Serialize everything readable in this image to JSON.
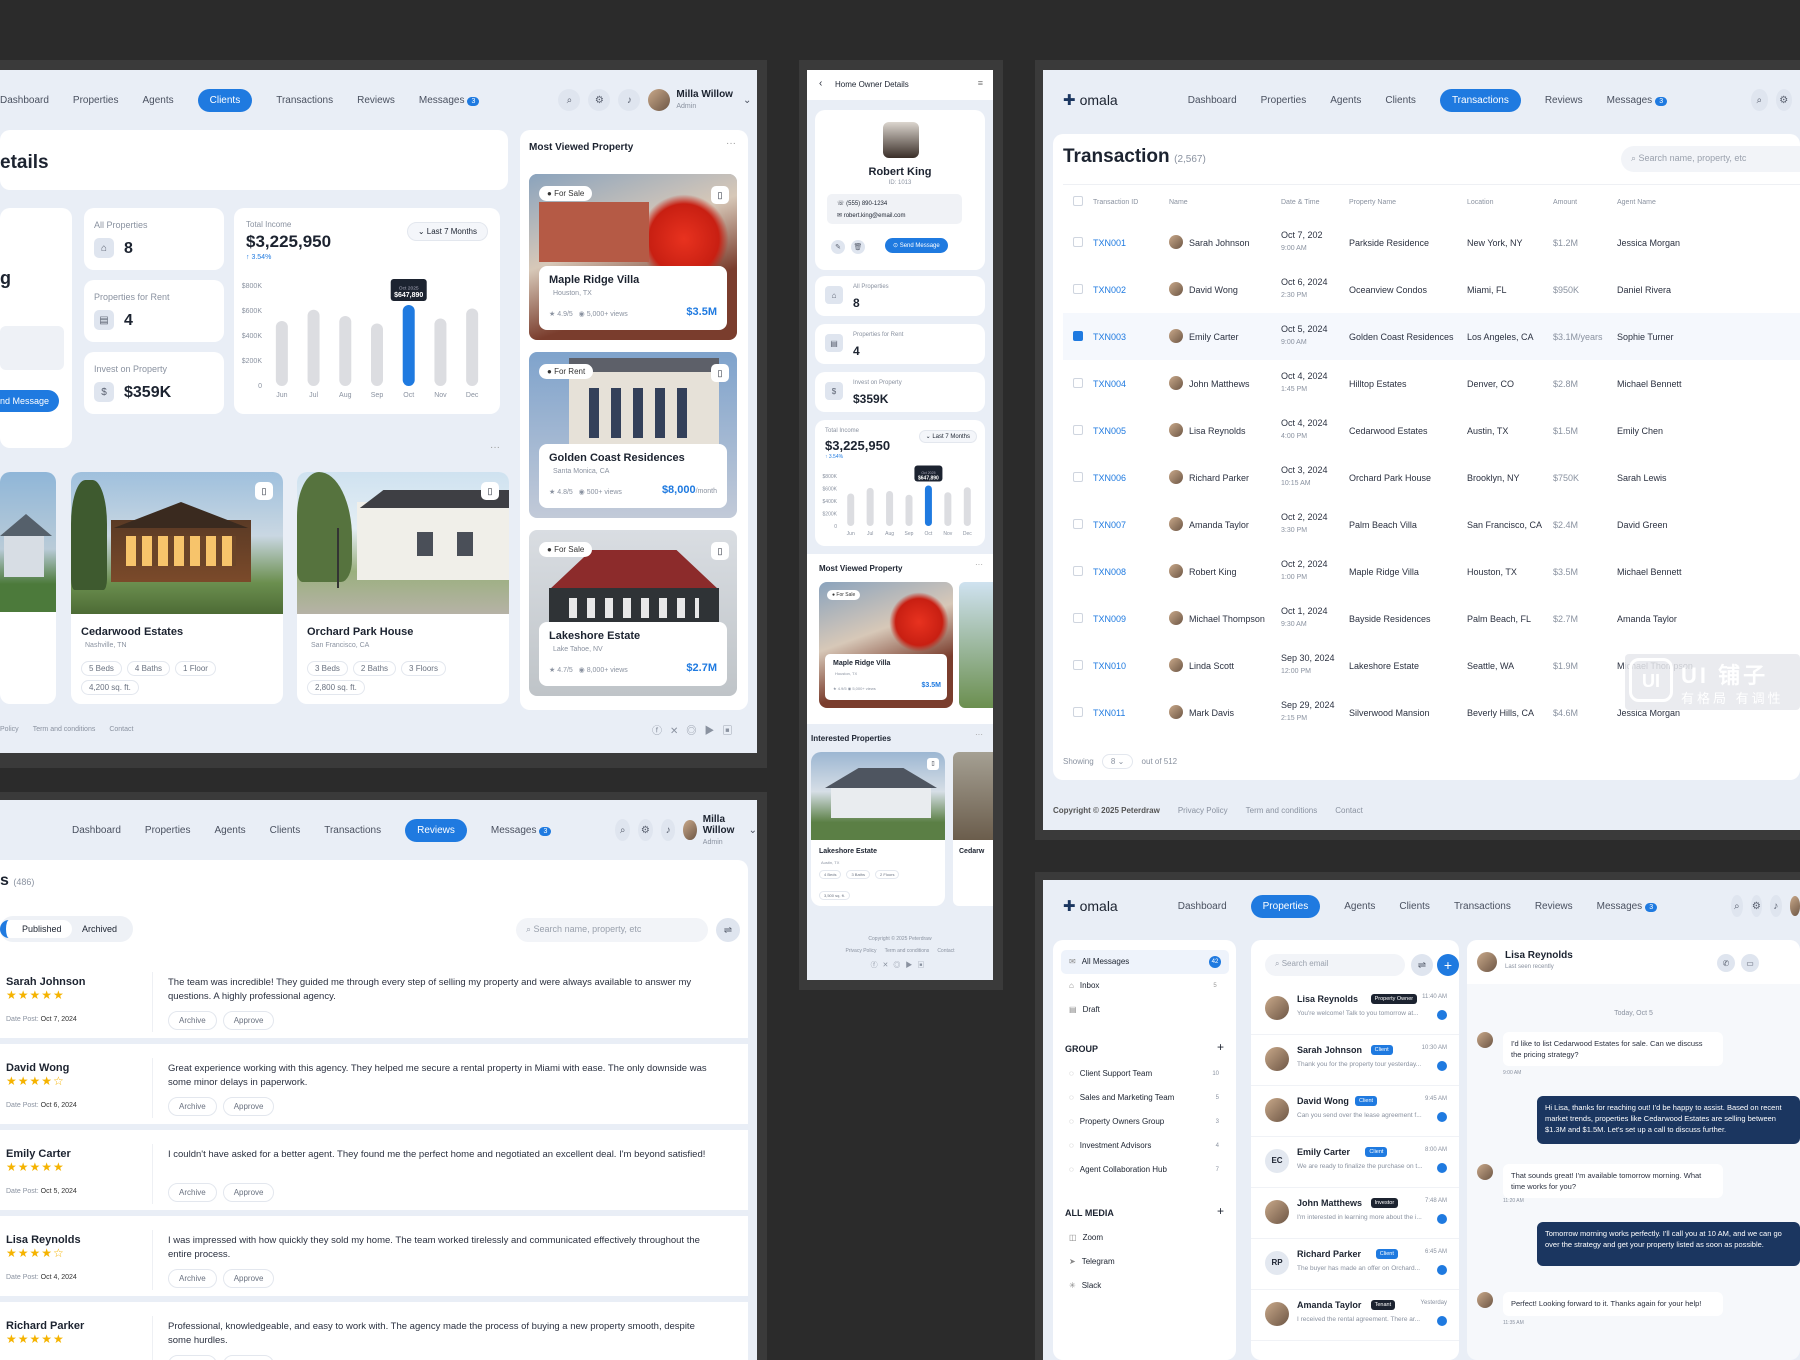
{
  "user": {
    "name": "Milla Willow",
    "role": "Admin"
  },
  "nav_a": [
    "Dashboard",
    "Properties",
    "Agents",
    "Clients",
    "Transactions",
    "Reviews",
    "Messages"
  ],
  "messages_badge": "3",
  "p1": {
    "active_tab": "Clients",
    "title": "etails",
    "stats": [
      {
        "label": "All Properties",
        "value": "8"
      },
      {
        "label": "Properties for Rent",
        "value": "4"
      },
      {
        "label": "Invest on Property",
        "value": "$359K"
      }
    ],
    "side_letter": "g",
    "send_btn": "nd Message",
    "income": {
      "label": "Total Income",
      "value": "$3,225,950",
      "delta": "↑ 3.54%",
      "range": "Last 7 Months",
      "tooltip_month": "Oct 2025",
      "tooltip_value": "$647,890"
    },
    "chart_data": {
      "type": "bar",
      "categories": [
        "Jun",
        "Jul",
        "Aug",
        "Sep",
        "Oct",
        "Nov",
        "Dec"
      ],
      "values": [
        520,
        610,
        560,
        500,
        647.89,
        540,
        620
      ],
      "highlight": "Oct",
      "ylabels": [
        "$800K",
        "$600K",
        "$400K",
        "$200K",
        "0"
      ],
      "ylim": [
        0,
        800
      ]
    },
    "bottom_props": [
      {
        "name": "Cedarwood Estates",
        "loc": "Nashville, TN",
        "beds": "5 Beds",
        "baths": "4 Baths",
        "floors": "1 Floor",
        "size": "4,200 sq. ft."
      },
      {
        "name": "Orchard Park House",
        "loc": "San Francisco, CA",
        "beds": "3 Beds",
        "baths": "2 Baths",
        "floors": "3 Floors",
        "size": "2,800 sq. ft."
      }
    ],
    "mv_title": "Most Viewed Property",
    "mv": [
      {
        "tag": "For Sale",
        "name": "Maple Ridge Villa",
        "loc": "Houston, TX",
        "rating": "4.9/5",
        "views": "5,000+ views",
        "price": "$3.5M",
        "per": ""
      },
      {
        "tag": "For Rent",
        "name": "Golden Coast Residences",
        "loc": "Santa Monica, CA",
        "rating": "4.8/5",
        "views": "500+ views",
        "price": "$8,000",
        "per": "/month"
      },
      {
        "tag": "For Sale",
        "name": "Lakeshore Estate",
        "loc": "Lake Tahoe, NV",
        "rating": "4.7/5",
        "views": "8,000+ views",
        "price": "$2.7M",
        "per": ""
      }
    ],
    "footer": [
      "Policy",
      "Term and conditions",
      "Contact"
    ]
  },
  "p2": {
    "header": "Home Owner Details",
    "name": "Robert King",
    "id": "ID: 1013",
    "phone": "(555) 890-1234",
    "email": "robert.king@email.com",
    "send": "Send Message",
    "stats": [
      {
        "label": "All Properties",
        "value": "8"
      },
      {
        "label": "Properties for Rent",
        "value": "4"
      },
      {
        "label": "Invest on Property",
        "value": "$359K"
      }
    ],
    "income_label": "Total Income",
    "income": "$3,225,950",
    "delta": "↑ 3.54%",
    "range": "Last 7 Months",
    "mv_title": "Most Viewed Property",
    "mv_card": {
      "tag": "For Sale",
      "name": "Maple Ridge Villa",
      "loc": "Houston, TX",
      "rating": "4.9/5",
      "views": "5,000+ views",
      "price": "$3.5M"
    },
    "int_title": "Interested Properties",
    "int_card": {
      "name": "Lakeshore Estate",
      "loc": "Austin, TX",
      "beds": "4 Beds",
      "baths": "3 Baths",
      "floors": "2 Floors",
      "size": "3,500 sq. ft."
    },
    "int_card2": "Cedarw",
    "copyright": "Copyright © 2025 Peterdraw",
    "links": [
      "Privacy Policy",
      "Term and conditions",
      "Contact"
    ]
  },
  "p3": {
    "brand": "omala",
    "active_tab": "Transactions",
    "title": "Transaction",
    "count": "(2,567)",
    "search": "Search name, property, etc",
    "headers": [
      "Transaction ID",
      "Name",
      "Date & Time",
      "Property Name",
      "Location",
      "Amount",
      "Agent Name"
    ],
    "rows": [
      {
        "id": "TXN001",
        "name": "Sarah Johnson",
        "date": "Oct 7, 202",
        "time": "9:00 AM",
        "prop": "Parkside Residence",
        "loc": "New York, NY",
        "amt": "$1.2M",
        "agent": "Jessica Morgan",
        "on": false
      },
      {
        "id": "TXN002",
        "name": "David Wong",
        "date": "Oct 6, 2024",
        "time": "2:30 PM",
        "prop": "Oceanview Condos",
        "loc": "Miami, FL",
        "amt": "$950K",
        "agent": "Daniel Rivera",
        "on": false
      },
      {
        "id": "TXN003",
        "name": "Emily Carter",
        "date": "Oct 5, 2024",
        "time": "9:00 AM",
        "prop": "Golden Coast Residences",
        "loc": "Los Angeles, CA",
        "amt": "$3.1M/years",
        "agent": "Sophie Turner",
        "on": true
      },
      {
        "id": "TXN004",
        "name": "John Matthews",
        "date": "Oct 4, 2024",
        "time": "1:45 PM",
        "prop": "Hilltop Estates",
        "loc": "Denver, CO",
        "amt": "$2.8M",
        "agent": "Michael Bennett",
        "on": false
      },
      {
        "id": "TXN005",
        "name": "Lisa Reynolds",
        "date": "Oct 4, 2024",
        "time": "4:00 PM",
        "prop": "Cedarwood Estates",
        "loc": "Austin, TX",
        "amt": "$1.5M",
        "agent": "Emily Chen",
        "on": false
      },
      {
        "id": "TXN006",
        "name": "Richard Parker",
        "date": "Oct 3, 2024",
        "time": "10:15 AM",
        "prop": "Orchard Park House",
        "loc": "Brooklyn, NY",
        "amt": "$750K",
        "agent": "Sarah Lewis",
        "on": false
      },
      {
        "id": "TXN007",
        "name": "Amanda Taylor",
        "date": "Oct 2, 2024",
        "time": "3:30 PM",
        "prop": "Palm Beach Villa",
        "loc": "San Francisco, CA",
        "amt": "$2.4M",
        "agent": "David Green",
        "on": false
      },
      {
        "id": "TXN008",
        "name": "Robert King",
        "date": "Oct 2, 2024",
        "time": "1:00 PM",
        "prop": "Maple Ridge Villa",
        "loc": "Houston, TX",
        "amt": "$3.5M",
        "agent": "Michael Bennett",
        "on": false
      },
      {
        "id": "TXN009",
        "name": "Michael Thompson",
        "date": "Oct 1, 2024",
        "time": "9:30 AM",
        "prop": "Bayside Residences",
        "loc": "Palm Beach, FL",
        "amt": "$2.7M",
        "agent": "Amanda Taylor",
        "on": false
      },
      {
        "id": "TXN010",
        "name": "Linda Scott",
        "date": "Sep 30, 2024",
        "time": "12:00 PM",
        "prop": "Lakeshore Estate",
        "loc": "Seattle, WA",
        "amt": "$1.9M",
        "agent": "Michael Thompson",
        "on": false
      },
      {
        "id": "TXN011",
        "name": "Mark Davis",
        "date": "Sep 29, 2024",
        "time": "2:15 PM",
        "prop": "Silverwood Mansion",
        "loc": "Beverly Hills, CA",
        "amt": "$4.6M",
        "agent": "Jessica Morgan",
        "on": false
      }
    ],
    "showing": "Showing",
    "per_page": "8",
    "of": "out of 512",
    "copyright": "Copyright © 2025 Peterdraw",
    "links": [
      "Privacy Policy",
      "Term and conditions",
      "Contact"
    ],
    "wm_big": "UI 铺子",
    "wm_small": "有格局 有调性"
  },
  "p4": {
    "active_tab": "Reviews",
    "title": "s",
    "count": "(486)",
    "tabs": [
      "Published",
      "Archived"
    ],
    "search": "Search name, property, etc",
    "date_label": "Date Post:",
    "archive": "Archive",
    "approve": "Approve",
    "reviews": [
      {
        "name": "Sarah Johnson",
        "stars": "★★★★★",
        "date": "Oct 7, 2024",
        "text": "The team was incredible! They guided me through every step of selling my property and were always available to answer my questions. A highly professional agency."
      },
      {
        "name": "David Wong",
        "stars": "★★★★☆",
        "date": "Oct 6, 2024",
        "text": "Great experience working with this agency. They helped me secure a rental property in Miami with ease. The only downside was some minor delays in paperwork."
      },
      {
        "name": "Emily Carter",
        "stars": "★★★★★",
        "date": "Oct 5, 2024",
        "text": "I couldn't have asked for a better agent. They found me the perfect home and negotiated an excellent deal. I'm beyond satisfied!"
      },
      {
        "name": "Lisa Reynolds",
        "stars": "★★★★☆",
        "date": "Oct 4, 2024",
        "text": "I was impressed with how quickly they sold my home. The team worked tirelessly and communicated effectively throughout the entire process."
      },
      {
        "name": "Richard Parker",
        "stars": "★★★★★",
        "date": "",
        "text": "Professional, knowledgeable, and easy to work with. The agency made the process of buying a new property smooth, despite some hurdles."
      }
    ]
  },
  "p5": {
    "brand": "omala",
    "active_tab": "Properties",
    "folders": [
      {
        "label": "All Messages",
        "count": "42"
      },
      {
        "label": "Inbox",
        "count": "5"
      },
      {
        "label": "Draft",
        "count": ""
      }
    ],
    "group_title": "GROUP",
    "groups": [
      {
        "label": "Client Support Team",
        "count": "10"
      },
      {
        "label": "Sales and Marketing Team",
        "count": "5"
      },
      {
        "label": "Property Owners Group",
        "count": "3"
      },
      {
        "label": "Investment Advisors",
        "count": "4"
      },
      {
        "label": "Agent Collaboration Hub",
        "count": "7"
      }
    ],
    "media_title": "ALL MEDIA",
    "media": [
      "Zoom",
      "Telegram",
      "Slack"
    ],
    "search": "Search email",
    "list": [
      {
        "name": "Lisa Reynolds",
        "role": "Property Owner",
        "time": "11:40 AM",
        "text": "You're welcome! Talk to you tomorrow at...",
        "init": ""
      },
      {
        "name": "Sarah Johnson",
        "role": "Client",
        "time": "10:30 AM",
        "text": "Thank you for the property tour yesterday...",
        "init": ""
      },
      {
        "name": "David Wong",
        "role": "Client",
        "time": "9:45 AM",
        "text": "Can you send over the lease agreement f...",
        "init": ""
      },
      {
        "name": "Emily Carter",
        "role": "Client",
        "time": "8:00 AM",
        "text": "We are ready to finalize the purchase on t...",
        "init": "EC"
      },
      {
        "name": "John Matthews",
        "role": "Investor",
        "time": "7:48 AM",
        "text": "I'm interested in learning more about the i...",
        "init": ""
      },
      {
        "name": "Richard Parker",
        "role": "Client",
        "time": "6:45 AM",
        "text": "The buyer has made an offer on Orchard...",
        "init": "RP"
      },
      {
        "name": "Amanda Taylor",
        "role": "Tenant",
        "time": "Yesterday",
        "text": "I received the rental agreement. There ar...",
        "init": ""
      }
    ],
    "chat_name": "Lisa Reynolds",
    "chat_status": "Last seen recently",
    "day": "Today, Oct 5",
    "msgs": [
      {
        "side": "in",
        "text": "I'd like to list Cedarwood Estates for sale. Can we discuss the pricing strategy?",
        "time": "9:00 AM"
      },
      {
        "side": "out",
        "text": "Hi Lisa, thanks for reaching out! I'd be happy to assist. Based on recent market trends, properties like Cedarwood Estates are selling between $1.3M and $1.5M. Let's set up a call to discuss further.",
        "time": ""
      },
      {
        "side": "in",
        "text": "That sounds great! I'm available tomorrow morning. What time works for you?",
        "time": "11:20 AM"
      },
      {
        "side": "out",
        "text": "Tomorrow morning works perfectly. I'll call you at 10 AM, and we can go over the strategy and get your property listed as soon as possible.",
        "time": ""
      },
      {
        "side": "in",
        "text": "Perfect! Looking forward to it. Thanks again for your help!",
        "time": "11:35 AM"
      }
    ]
  }
}
